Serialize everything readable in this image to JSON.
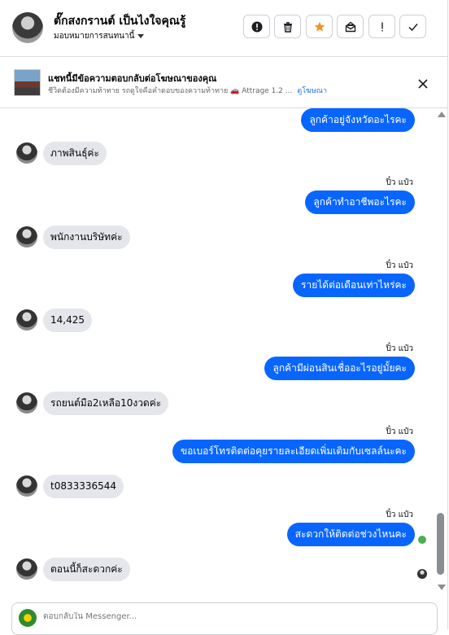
{
  "header": {
    "name": "ตั๊กสงกรานต์ เป็นไงใจคุณรู้",
    "assign_label": "มอบหมายการสนทนานี้",
    "toolbar": [
      "alert-circle",
      "trash",
      "star",
      "mark-unread",
      "exclamation",
      "check"
    ]
  },
  "ad": {
    "title": "แชทนี้มีข้อความตอบกลับต่อโฆษณาของคุณ",
    "subtitle": "ชีวิตต้องมีความท้าทาย รถดูใจคือคำตอบของความท้าทาย 🚗 Attrage 1.2 ...",
    "link": "ดูโฆษณา"
  },
  "messages": [
    {
      "dir": "out",
      "text": "ลูกค้าอยู่จังหวัดอะไรคะ",
      "seen": ""
    },
    {
      "dir": "in",
      "text": "ภาพสินธุ์ค่ะ"
    },
    {
      "dir": "out",
      "text": "ลูกค้าทำอาชีพอะไรคะ",
      "seen": "ปิ๋ว แป๋ว"
    },
    {
      "dir": "in",
      "text": "พนักงานบริษัทค่ะ"
    },
    {
      "dir": "out",
      "text": "รายได้ต่อเดือนเท่าไหร่คะ",
      "seen": "ปิ๋ว แป๋ว"
    },
    {
      "dir": "in",
      "text": "14,425"
    },
    {
      "dir": "out",
      "text": "ลูกค้ามีผ่อนสินเชื่ออะไรอยู่มั้ยคะ",
      "seen": "ปิ๋ว แป๋ว"
    },
    {
      "dir": "in",
      "text": "รถยนต์มือ2เหลือ10งวดค่ะ"
    },
    {
      "dir": "out",
      "text": "ขอเบอร์โทรติดต่อคุยรายละเอียดเพิ่มเติมกับเซลล์นะคะ",
      "seen": "ปิ๋ว แป๋ว"
    },
    {
      "dir": "in",
      "text": "t0833336544"
    },
    {
      "dir": "out",
      "text": "สะดวกให้ติดต่อช่วงไหนคะ",
      "seen": "ปิ๋ว แป๋ว"
    },
    {
      "dir": "in",
      "text": "ตอนนี้ก็สะดวกค่ะ"
    }
  ],
  "composer": {
    "placeholder": "ตอบกลับใน Messenger..."
  },
  "colors": {
    "outgoing_bubble": "#0866ff",
    "incoming_bubble": "#e4e6eb",
    "star_active": "#f7931e",
    "link": "#1b74e4"
  }
}
